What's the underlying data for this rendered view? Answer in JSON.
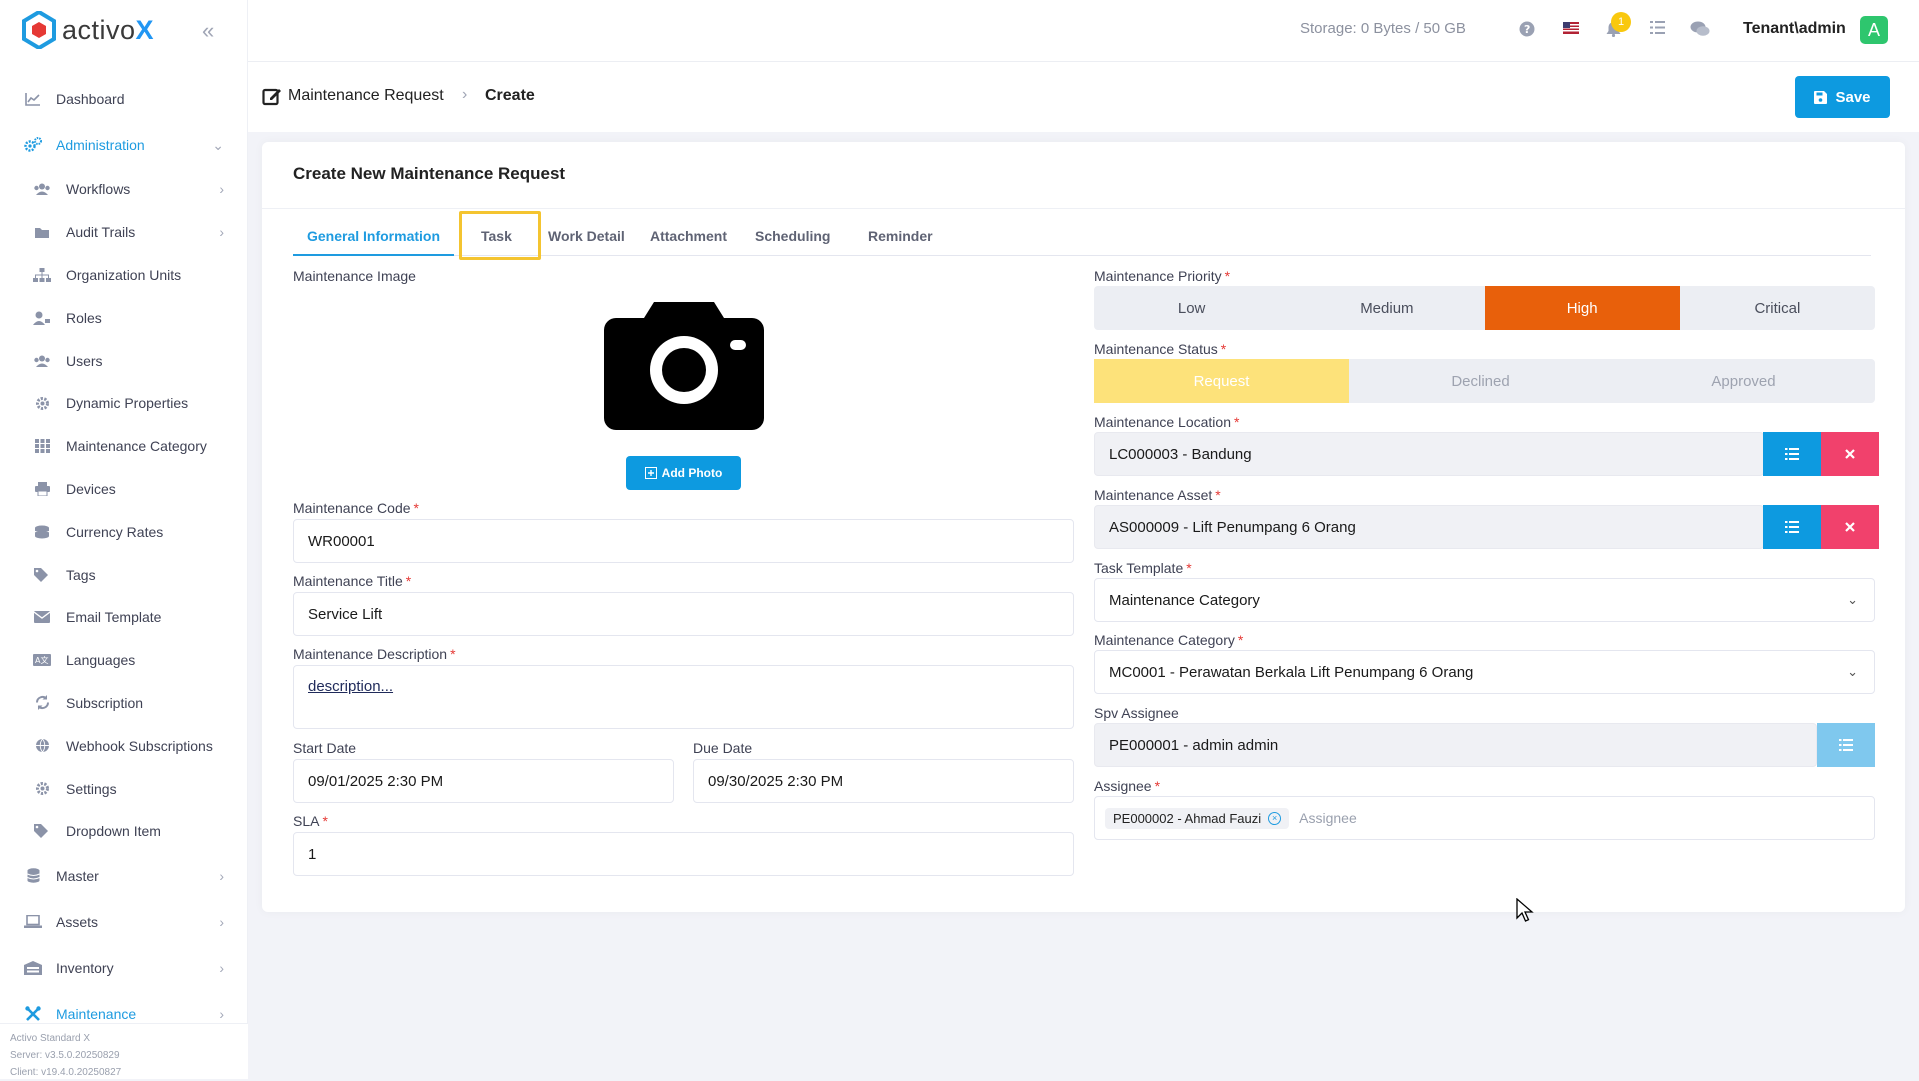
{
  "brand": {
    "name_prefix": "activo",
    "name_suffix": "X"
  },
  "sidebar": {
    "items": [
      {
        "label": "Dashboard",
        "icon": "chart-line-icon"
      },
      {
        "label": "Administration",
        "icon": "cogs-icon"
      }
    ],
    "admin_sub": [
      {
        "label": "Workflows",
        "icon": "users-icon"
      },
      {
        "label": "Audit Trails",
        "icon": "folder-icon"
      },
      {
        "label": "Organization Units",
        "icon": "sitemap-icon"
      },
      {
        "label": "Roles",
        "icon": "user-tag-icon"
      },
      {
        "label": "Users",
        "icon": "users-icon"
      },
      {
        "label": "Dynamic Properties",
        "icon": "gear-icon"
      },
      {
        "label": "Maintenance Category",
        "icon": "grid-icon"
      },
      {
        "label": "Devices",
        "icon": "printer-icon"
      },
      {
        "label": "Currency Rates",
        "icon": "coins-icon"
      },
      {
        "label": "Tags",
        "icon": "tags-icon"
      },
      {
        "label": "Email Template",
        "icon": "envelope-icon"
      },
      {
        "label": "Languages",
        "icon": "language-icon"
      },
      {
        "label": "Subscription",
        "icon": "sync-icon"
      },
      {
        "label": "Webhook Subscriptions",
        "icon": "globe-icon"
      },
      {
        "label": "Settings",
        "icon": "gear-icon"
      },
      {
        "label": "Dropdown Item",
        "icon": "tags-icon"
      }
    ],
    "bottom_items": [
      {
        "label": "Master",
        "icon": "database-icon"
      },
      {
        "label": "Assets",
        "icon": "laptop-icon"
      },
      {
        "label": "Inventory",
        "icon": "warehouse-icon"
      },
      {
        "label": "Maintenance",
        "icon": "tools-icon"
      }
    ],
    "footer": {
      "edition": "Activo Standard X",
      "server": "Server: v3.5.0.20250829",
      "client": "Client: v19.4.0.20250827"
    }
  },
  "header": {
    "storage": "Storage: 0 Bytes / 50 GB",
    "notification_count": "1",
    "user": "Tenant\\admin",
    "avatar_letter": "A"
  },
  "breadcrumb": {
    "parent": "Maintenance Request",
    "current": "Create"
  },
  "toolbar": {
    "save_label": "Save"
  },
  "form": {
    "title": "Create New Maintenance Request",
    "tabs": [
      "General Information",
      "Task",
      "Work Detail",
      "Attachment",
      "Scheduling",
      "Reminder"
    ],
    "image_label": "Maintenance Image",
    "add_photo_label": "Add Photo",
    "code_label": "Maintenance Code",
    "code_value": "WR00001",
    "title_label": "Maintenance Title",
    "title_value": "Service Lift",
    "desc_label": "Maintenance Description",
    "desc_value": "description...",
    "start_label": "Start Date",
    "start_value": "09/01/2025 2:30 PM",
    "due_label": "Due Date",
    "due_value": "09/30/2025 2:30 PM",
    "sla_label": "SLA",
    "sla_value": "1",
    "priority_label": "Maintenance Priority",
    "priority_options": [
      "Low",
      "Medium",
      "High",
      "Critical"
    ],
    "priority_selected": "High",
    "status_label": "Maintenance Status",
    "status_options": [
      "Request",
      "Declined",
      "Approved"
    ],
    "status_selected": "Request",
    "location_label": "Maintenance Location",
    "location_value": "LC000003 - Bandung",
    "asset_label": "Maintenance Asset",
    "asset_value": "AS000009 - Lift Penumpang 6 Orang",
    "template_label": "Task Template",
    "template_value": "Maintenance Category",
    "category_label": "Maintenance Category",
    "category_value": "MC0001 - Perawatan Berkala Lift Penumpang 6 Orang",
    "spv_label": "Spv Assignee",
    "spv_value": "PE000001 - admin admin",
    "assignee_label": "Assignee",
    "assignee_chip": "PE000002 - Ahmad Fauzi",
    "assignee_placeholder": "Assignee",
    "required_mark": "*"
  },
  "colors": {
    "primary": "#0d9ae0",
    "danger": "#f1416c",
    "priority_high": "#e8600b",
    "status_request": "#fde27a",
    "highlight": "#f4c430"
  }
}
